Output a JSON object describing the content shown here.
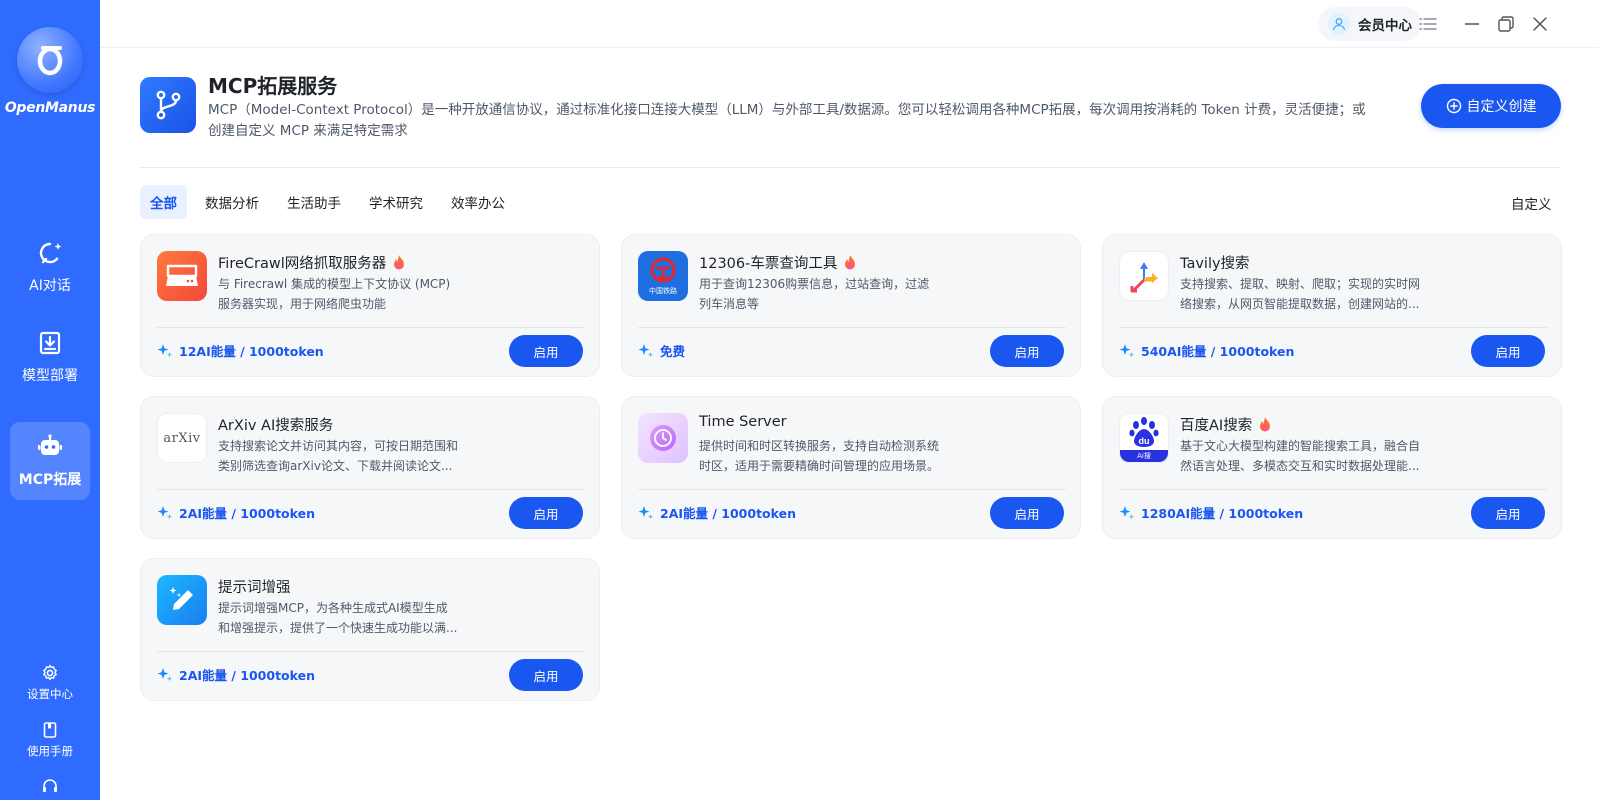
{
  "app": {
    "name": "OpenManus"
  },
  "sidebar": {
    "items": [
      {
        "label": "AI对话"
      },
      {
        "label": "模型部署"
      },
      {
        "label": "MCP拓展"
      }
    ],
    "bottom": [
      {
        "label": "设置中心"
      },
      {
        "label": "使用手册"
      }
    ]
  },
  "topbar": {
    "member_label": "会员中心"
  },
  "header": {
    "title": "MCP拓展服务",
    "description": "MCP（Model-Context Protocol）是一种开放通信协议，通过标准化接口连接大模型（LLM）与外部工具/数据源。您可以轻松调用各种MCP拓展，每次调用按消耗的 Token 计费，灵活便捷；或创建自定义 MCP 来满足特定需求",
    "create_button": "自定义创建"
  },
  "tabs": [
    {
      "label": "全部",
      "active": true
    },
    {
      "label": "数据分析"
    },
    {
      "label": "生活助手"
    },
    {
      "label": "学术研究"
    },
    {
      "label": "效率办公"
    }
  ],
  "custom_link": "自定义",
  "cards": [
    {
      "title": "FireCrawl网络抓取服务器",
      "hot": true,
      "desc": "与 Firecrawl 集成的模型上下文协议 (MCP) 服务器实现，用于网络爬虫功能",
      "price": "12AI能量 / 1000token",
      "button": "启用",
      "logo": "firecrawl-logo"
    },
    {
      "title": "12306-车票查询工具",
      "hot": true,
      "desc": "用于查询12306购票信息，过站查询，过滤列车消息等",
      "price": "免费",
      "button": "启用",
      "logo": "china-railway-logo",
      "logo_text": "中国铁路"
    },
    {
      "title": "Tavily搜索",
      "hot": false,
      "desc": "支持搜索、提取、映射、爬取；实现的实时网络搜索，从网页智能提取数据，创建网站的...",
      "price": "540AI能量 / 1000token",
      "button": "启用",
      "logo": "tavily-logo"
    },
    {
      "title": "ArXiv AI搜索服务",
      "hot": false,
      "desc": "支持搜索论文并访问其内容，可按日期范围和类别筛选查询arXiv论文、下载并阅读论文...",
      "price": "2AI能量 / 1000token",
      "button": "启用",
      "logo": "arxiv-logo",
      "logo_text": "arXiv"
    },
    {
      "title": "Time Server",
      "hot": false,
      "desc": "提供时间和时区转换服务，支持自动检测系统时区，适用于需要精确时间管理的应用场景。",
      "price": "2AI能量 / 1000token",
      "button": "启用",
      "logo": "clock-logo"
    },
    {
      "title": "百度AI搜索",
      "hot": true,
      "desc": "基于文心大模型构建的智能搜索工具，融合自然语言处理、多模态交互和实时数据处理能...",
      "price": "1280AI能量 / 1000token",
      "button": "启用",
      "logo": "baidu-logo",
      "logo_text": "Ai搜"
    },
    {
      "title": "提示词增强",
      "hot": false,
      "desc": "提示词增强MCP，为各种生成式AI模型生成和增强提示，提供了一个快速生成功能以满...",
      "price": "2AI能量 / 1000token",
      "button": "启用",
      "logo": "prompt-pen-logo"
    }
  ],
  "colors": {
    "sidebar": "#2f6bff",
    "primary": "#1a56f0",
    "card_bg": "#f6f7f9"
  }
}
